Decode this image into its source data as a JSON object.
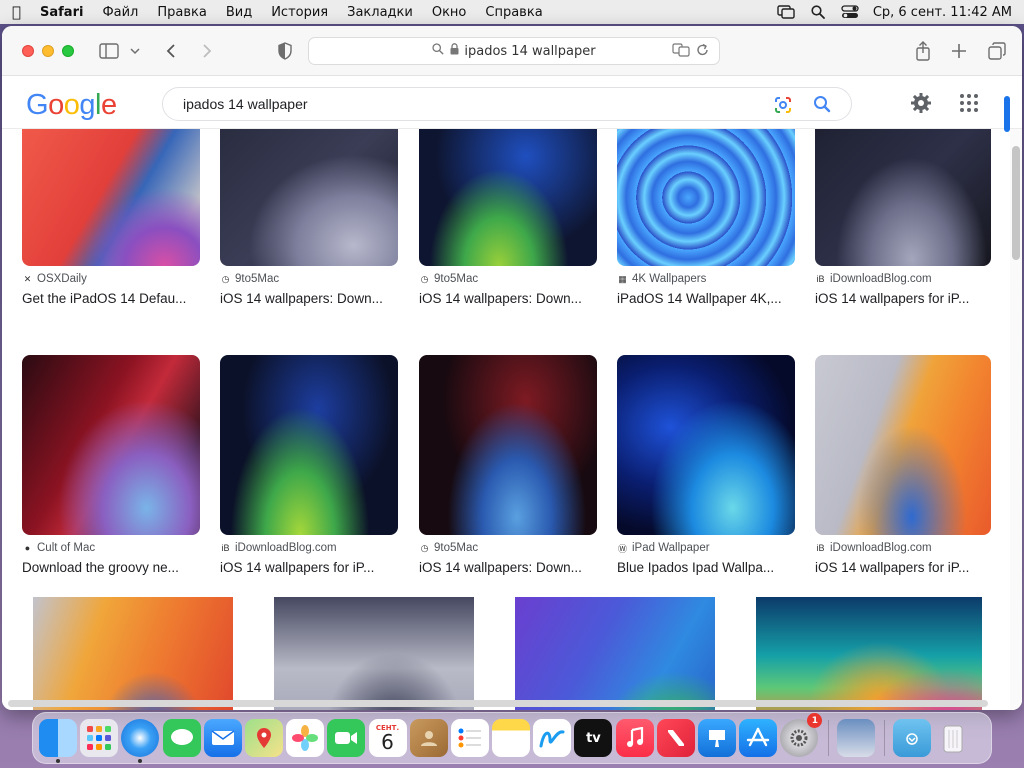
{
  "menubar": {
    "app": "Safari",
    "items": [
      "Файл",
      "Правка",
      "Вид",
      "История",
      "Закладки",
      "Окно",
      "Справка"
    ],
    "clock": "Ср, 6 сент.  11:42 AM"
  },
  "browser": {
    "address": "ipados 14 wallpaper"
  },
  "google": {
    "logo": [
      "G",
      "o",
      "o",
      "g",
      "l",
      "e"
    ],
    "query": "ipados 14 wallpaper"
  },
  "results": [
    {
      "source": "OSXDaily",
      "title": "Get the iPadOS 14 Defau..."
    },
    {
      "source": "9to5Mac",
      "title": "iOS 14 wallpapers: Down..."
    },
    {
      "source": "9to5Mac",
      "title": "iOS 14 wallpapers: Down..."
    },
    {
      "source": "4K Wallpapers",
      "title": "iPadOS 14 Wallpaper 4K,..."
    },
    {
      "source": "iDownloadBlog.com",
      "title": "iOS 14 wallpapers for iP..."
    },
    {
      "source": "Cult of Mac",
      "title": "Download the groovy ne..."
    },
    {
      "source": "iDownloadBlog.com",
      "title": "iOS 14 wallpapers for iP..."
    },
    {
      "source": "9to5Mac",
      "title": "iOS 14 wallpapers: Down..."
    },
    {
      "source": "iPad Wallpaper",
      "title": "Blue Ipados Ipad Wallpa..."
    },
    {
      "source": "iDownloadBlog.com",
      "title": "iOS 14 wallpapers for iP..."
    }
  ],
  "dock": {
    "calendar_month": "СЕНТ.",
    "calendar_day": "6",
    "settings_badge": "1",
    "tv_label": "tv"
  },
  "colors": {
    "google_blue": "#4285f4",
    "google_red": "#ea4335",
    "google_yellow": "#fbbc05",
    "google_green": "#34a853"
  }
}
